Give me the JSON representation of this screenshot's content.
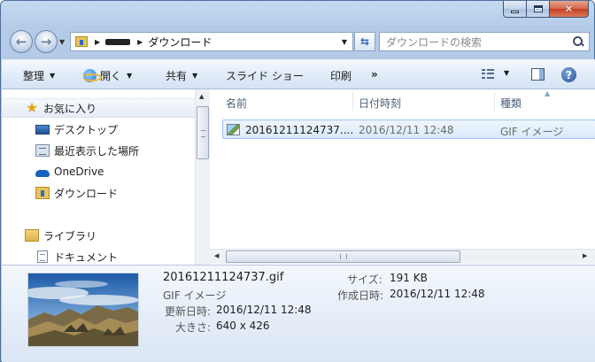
{
  "window": {
    "caption": {
      "minimize": "—",
      "maximize": "□",
      "close": "✕"
    }
  },
  "nav": {
    "address_text": "ダウンロード",
    "search_placeholder": "ダウンロードの検索"
  },
  "toolbar": {
    "organize": "整理",
    "open": "開く",
    "share": "共有",
    "slideshow": "スライド ショー",
    "print": "印刷",
    "more": "»"
  },
  "sidebar": {
    "items": [
      {
        "label": "お気に入り",
        "icon": "star-icon"
      },
      {
        "label": "デスクトップ",
        "icon": "desktop-icon"
      },
      {
        "label": "最近表示した場所",
        "icon": "recent-places-icon"
      },
      {
        "label": "OneDrive",
        "icon": "onedrive-cloud-icon"
      },
      {
        "label": "ダウンロード",
        "icon": "downloads-folder-icon"
      },
      {
        "label": "ライブラリ",
        "icon": "libraries-icon"
      },
      {
        "label": "ドキュメント",
        "icon": "documents-icon"
      }
    ]
  },
  "filelist": {
    "columns": [
      "名前",
      "日付時刻",
      "種類"
    ],
    "rows": [
      {
        "name": "20161211124737....",
        "date": "2016/12/11 12:48",
        "type": "GIF イメージ"
      }
    ]
  },
  "details": {
    "filename": "20161211124737.gif",
    "filetype": "GIF イメージ",
    "modified_label": "更新日時:",
    "modified_value": "2016/12/11 12:48",
    "dimensions_label": "大きさ:",
    "dimensions_value": "640 x 426",
    "size_label": "サイズ:",
    "size_value": "191 KB",
    "created_label": "作成日時:",
    "created_value": "2016/12/11 12:48"
  },
  "colors": {
    "chrome": "#b9cde9",
    "selection": "#dbeafc",
    "selection_border": "#9cc3ee"
  }
}
